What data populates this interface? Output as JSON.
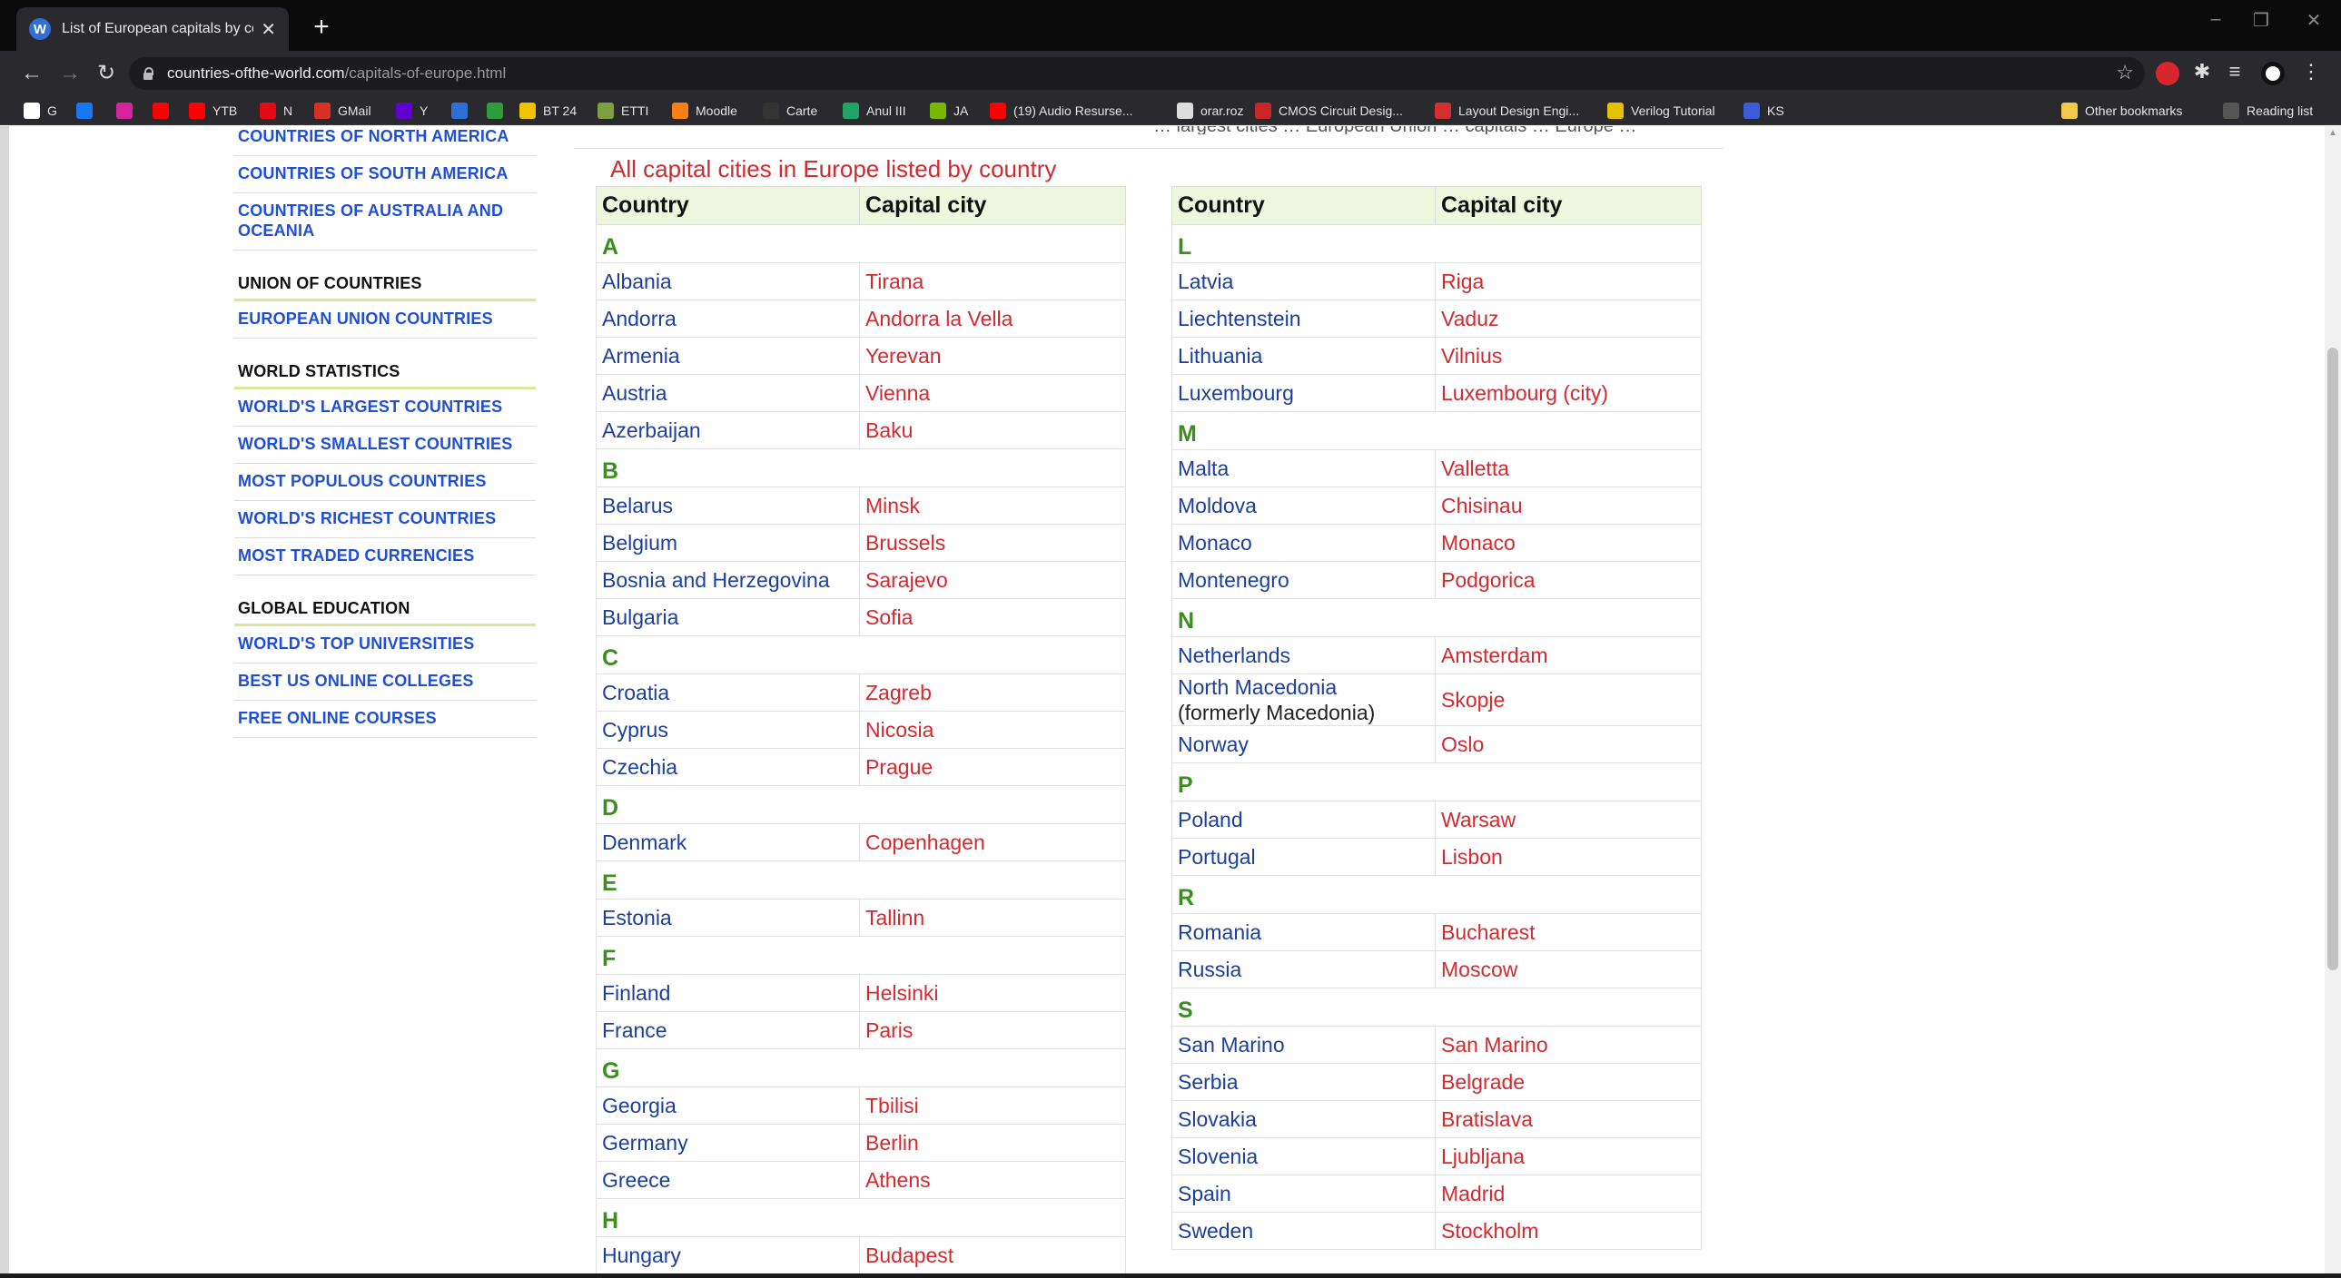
{
  "browser": {
    "tab_title": "List of European capitals by coun",
    "tab_favicon": "W",
    "url_host": "countries-ofthe-world.com",
    "url_path": "/capitals-of-europe.html",
    "bookmarks": [
      {
        "label": "G",
        "icon": "google-icon",
        "color": "#ffffff"
      },
      {
        "label": "",
        "icon": "facebook-icon",
        "color": "#1877f2"
      },
      {
        "label": "",
        "icon": "instagram-icon",
        "color": "#d6249f"
      },
      {
        "label": "",
        "icon": "youtube-icon",
        "color": "#ff0000"
      },
      {
        "label": "YTB",
        "icon": "youtube-icon",
        "color": "#ff0000"
      },
      {
        "label": "N",
        "icon": "netflix-icon",
        "color": "#e50914"
      },
      {
        "label": "GMail",
        "icon": "gmail-icon",
        "color": "#d93025"
      },
      {
        "label": "Y",
        "icon": "yahoo-icon",
        "color": "#6001d2"
      },
      {
        "label": "",
        "icon": "fl-icon",
        "color": "#2f6fd6"
      },
      {
        "label": "",
        "icon": "refresh-green-icon",
        "color": "#2e9d3c"
      },
      {
        "label": "BT 24",
        "icon": "bank-icon",
        "color": "#f2c300"
      },
      {
        "label": "ETTI",
        "icon": "etti-icon",
        "color": "#7ea040"
      },
      {
        "label": "Moodle",
        "icon": "moodle-icon",
        "color": "#f98012"
      },
      {
        "label": "Carte",
        "icon": "book-icon",
        "color": "#333333"
      },
      {
        "label": "Anul III",
        "icon": "drive-icon",
        "color": "#1fa463"
      },
      {
        "label": "JA",
        "icon": "nvidia-icon",
        "color": "#76b900"
      },
      {
        "label": "(19) Audio Resurse...",
        "icon": "youtube-icon",
        "color": "#ff0000"
      },
      {
        "label": "orar.roz",
        "icon": "document-icon",
        "color": "#dddddd"
      },
      {
        "label": "CMOS Circuit Desig...",
        "icon": "cmos-icon",
        "color": "#c62828"
      },
      {
        "label": "Layout Design Engi...",
        "icon": "layout-icon",
        "color": "#d32f2f"
      },
      {
        "label": "Verilog Tutorial",
        "icon": "verilog-icon",
        "color": "#e5c100"
      },
      {
        "label": "KS",
        "icon": "ks-icon",
        "color": "#3b5bdb"
      }
    ],
    "other_bookmarks": "Other bookmarks",
    "reading_list": "Reading list"
  },
  "sidebar": {
    "top_links": [
      "COUNTRIES OF NORTH AMERICA",
      "COUNTRIES OF SOUTH AMERICA",
      "COUNTRIES OF AUSTRALIA AND OCEANIA"
    ],
    "union_title": "UNION OF COUNTRIES",
    "union_links": [
      "EUROPEAN UNION COUNTRIES"
    ],
    "stats_title": "WORLD STATISTICS",
    "stats_links": [
      "WORLD'S LARGEST COUNTRIES",
      "WORLD'S SMALLEST COUNTRIES",
      "MOST POPULOUS COUNTRIES",
      "WORLD'S RICHEST COUNTRIES",
      "MOST TRADED CURRENCIES"
    ],
    "edu_title": "GLOBAL EDUCATION",
    "edu_links": [
      "WORLD'S TOP UNIVERSITIES",
      "BEST US ONLINE COLLEGES",
      "FREE ONLINE COURSES"
    ]
  },
  "content": {
    "cut_text": "… largest cities … European Union … capitals … Europe …",
    "section_title": "All capital cities in Europe listed by country",
    "col_country": "Country",
    "col_capital": "Capital city",
    "left_table": [
      {
        "letter": "A"
      },
      {
        "country": "Albania",
        "capital": "Tirana"
      },
      {
        "country": "Andorra",
        "capital": "Andorra la Vella"
      },
      {
        "country": "Armenia",
        "capital": "Yerevan"
      },
      {
        "country": "Austria",
        "capital": "Vienna"
      },
      {
        "country": "Azerbaijan",
        "capital": "Baku"
      },
      {
        "letter": "B"
      },
      {
        "country": "Belarus",
        "capital": "Minsk"
      },
      {
        "country": "Belgium",
        "capital": "Brussels"
      },
      {
        "country": "Bosnia and Herzegovina",
        "capital": "Sarajevo"
      },
      {
        "country": "Bulgaria",
        "capital": "Sofia"
      },
      {
        "letter": "C"
      },
      {
        "country": "Croatia",
        "capital": "Zagreb"
      },
      {
        "country": "Cyprus",
        "capital": "Nicosia"
      },
      {
        "country": "Czechia",
        "capital": "Prague"
      },
      {
        "letter": "D"
      },
      {
        "country": "Denmark",
        "capital": "Copenhagen"
      },
      {
        "letter": "E"
      },
      {
        "country": "Estonia",
        "capital": "Tallinn"
      },
      {
        "letter": "F"
      },
      {
        "country": "Finland",
        "capital": "Helsinki"
      },
      {
        "country": "France",
        "capital": "Paris"
      },
      {
        "letter": "G"
      },
      {
        "country": "Georgia",
        "capital": "Tbilisi"
      },
      {
        "country": "Germany",
        "capital": "Berlin"
      },
      {
        "country": "Greece",
        "capital": "Athens"
      },
      {
        "letter": "H"
      },
      {
        "country": "Hungary",
        "capital": "Budapest"
      }
    ],
    "right_table": [
      {
        "letter": "L"
      },
      {
        "country": "Latvia",
        "capital": "Riga"
      },
      {
        "country": "Liechtenstein",
        "capital": "Vaduz"
      },
      {
        "country": "Lithuania",
        "capital": "Vilnius"
      },
      {
        "country": "Luxembourg",
        "capital": "Luxembourg (city)"
      },
      {
        "letter": "M"
      },
      {
        "country": "Malta",
        "capital": "Valletta"
      },
      {
        "country": "Moldova",
        "capital": "Chisinau"
      },
      {
        "country": "Monaco",
        "capital": "Monaco"
      },
      {
        "country": "Montenegro",
        "capital": "Podgorica"
      },
      {
        "letter": "N"
      },
      {
        "country": "Netherlands",
        "capital": "Amsterdam"
      },
      {
        "country": "North Macedonia",
        "country_note": "(formerly Macedonia)",
        "capital": "Skopje"
      },
      {
        "country": "Norway",
        "capital": "Oslo"
      },
      {
        "letter": "P"
      },
      {
        "country": "Poland",
        "capital": "Warsaw"
      },
      {
        "country": "Portugal",
        "capital": "Lisbon"
      },
      {
        "letter": "R"
      },
      {
        "country": "Romania",
        "capital": "Bucharest"
      },
      {
        "country": "Russia",
        "capital": "Moscow"
      },
      {
        "letter": "S"
      },
      {
        "country": "San Marino",
        "capital": "San Marino"
      },
      {
        "country": "Serbia",
        "capital": "Belgrade"
      },
      {
        "country": "Slovakia",
        "capital": "Bratislava"
      },
      {
        "country": "Slovenia",
        "capital": "Ljubljana"
      },
      {
        "country": "Spain",
        "capital": "Madrid"
      },
      {
        "country": "Sweden",
        "capital": "Stockholm"
      }
    ]
  }
}
